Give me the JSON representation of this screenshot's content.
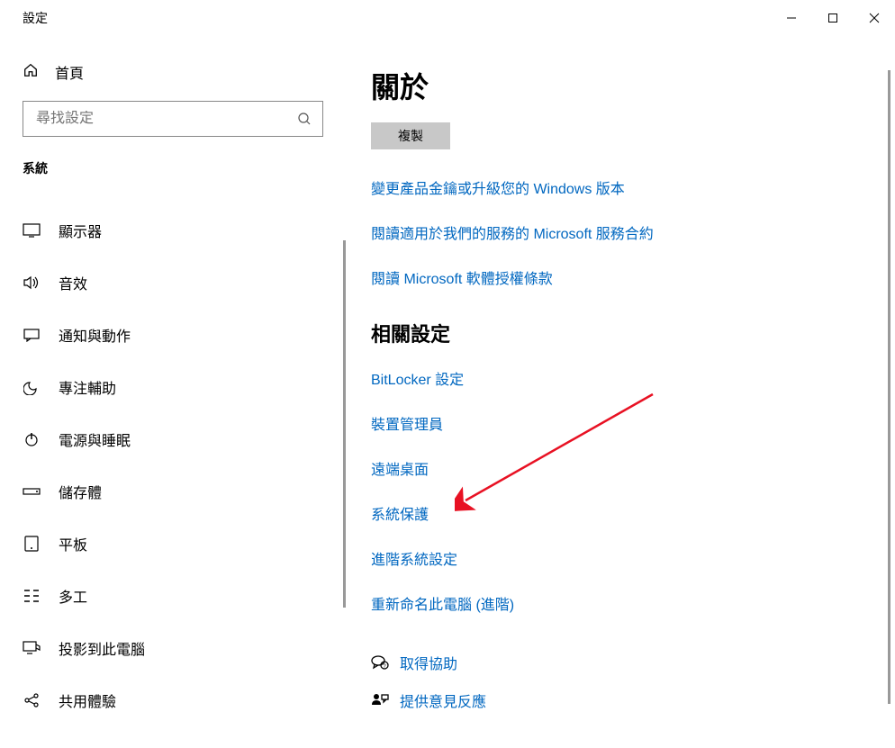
{
  "window": {
    "title": "設定"
  },
  "sidebar": {
    "home_label": "首頁",
    "search_placeholder": "尋找設定",
    "category_label": "系統",
    "items": [
      {
        "label": "顯示器"
      },
      {
        "label": "音效"
      },
      {
        "label": "通知與動作"
      },
      {
        "label": "專注輔助"
      },
      {
        "label": "電源與睡眠"
      },
      {
        "label": "儲存體"
      },
      {
        "label": "平板"
      },
      {
        "label": "多工"
      },
      {
        "label": "投影到此電腦"
      },
      {
        "label": "共用體驗"
      }
    ]
  },
  "main": {
    "heading": "關於",
    "copy_button": "複製",
    "product_links": [
      "變更產品金鑰或升級您的 Windows 版本",
      "閱讀適用於我們的服務的 Microsoft 服務合約",
      "閱讀 Microsoft 軟體授權條款"
    ],
    "related_heading": "相關設定",
    "related_links": [
      "BitLocker 設定",
      "裝置管理員",
      "遠端桌面",
      "系統保護",
      "進階系統設定",
      "重新命名此電腦 (進階)"
    ],
    "help_links": [
      "取得協助",
      "提供意見反應"
    ]
  }
}
